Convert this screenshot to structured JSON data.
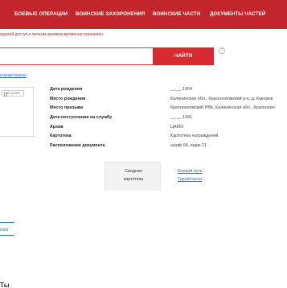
{
  "nav": {
    "items": [
      "БОЕВЫЕ ОПЕРАЦИИ",
      "ВОИНСКИЕ ЗАХОРОНЕНИЯ",
      "ВОИНСКИЕ ЧАСТИ",
      "ДОКУМЕНТЫ ЧАСТЕЙ"
    ]
  },
  "notice": "грузкой доступ к личным архивам временно ограничен.",
  "search": {
    "value": "",
    "button_label": "НАЙТИ",
    "help_glyph": "?"
  },
  "back_link": "ьтатам поиска",
  "archive_badge": "В архив",
  "info": [
    {
      "label": "Дата рождения",
      "value": "__.__.1904"
    },
    {
      "label": "Место рождения",
      "value": "Калининская обл., Краснохолмский р-н, д. Какорев"
    },
    {
      "label": "Место призыва",
      "value": "Краснохолмский РВК, Калининская обл., Краснохол"
    },
    {
      "label": "Дата поступления на службу",
      "value": "__.__.1941"
    },
    {
      "label": "Архив",
      "value": "ЦАМО"
    },
    {
      "label": "Картотека",
      "value": "Картотека награждений"
    },
    {
      "label": "Расположение документа",
      "value": "шкаф 64, ящик 21"
    }
  ],
  "tabs": {
    "active_line1": "Сводная",
    "active_line2": "картотека",
    "link1": "Боевой путь",
    "link2": "Герои/части"
  },
  "fragment_text": "ivelo",
  "fragment_bottom": "Ты"
}
